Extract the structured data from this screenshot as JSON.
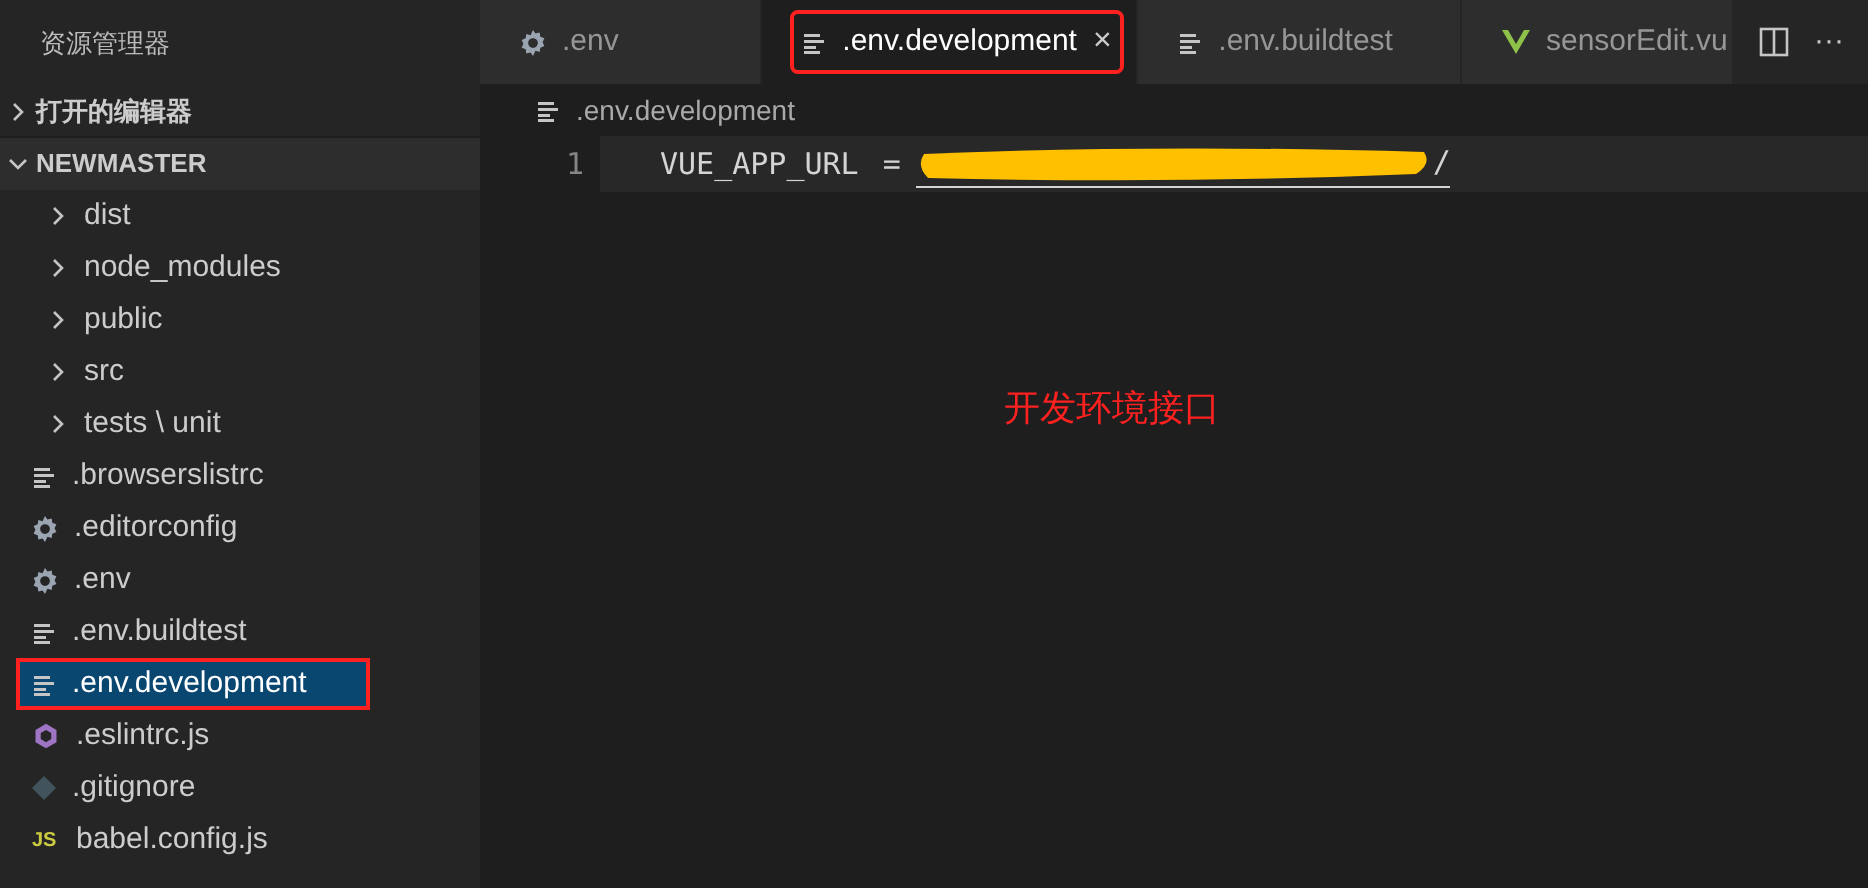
{
  "sidebar": {
    "title": "资源管理器",
    "sections": [
      {
        "label": "打开的编辑器",
        "expanded": false
      },
      {
        "label": "NEWMASTER",
        "expanded": true
      }
    ],
    "items": [
      {
        "kind": "folder",
        "label": "dist",
        "selected": false,
        "annotated": false
      },
      {
        "kind": "folder",
        "label": "node_modules",
        "selected": false,
        "annotated": false
      },
      {
        "kind": "folder",
        "label": "public",
        "selected": false,
        "annotated": false
      },
      {
        "kind": "folder",
        "label": "src",
        "selected": false,
        "annotated": false
      },
      {
        "kind": "folder",
        "label": "tests \\ unit",
        "selected": false,
        "annotated": false
      },
      {
        "kind": "lines",
        "label": ".browserslistrc",
        "selected": false,
        "annotated": false
      },
      {
        "kind": "gear",
        "label": ".editorconfig",
        "selected": false,
        "annotated": false
      },
      {
        "kind": "gear",
        "label": ".env",
        "selected": false,
        "annotated": false
      },
      {
        "kind": "lines",
        "label": ".env.buildtest",
        "selected": false,
        "annotated": false
      },
      {
        "kind": "lines",
        "label": ".env.development",
        "selected": true,
        "annotated": true
      },
      {
        "kind": "eslint",
        "label": ".eslintrc.js",
        "selected": false,
        "annotated": false
      },
      {
        "kind": "git",
        "label": ".gitignore",
        "selected": false,
        "annotated": false
      },
      {
        "kind": "js",
        "label": "babel.config.js",
        "selected": false,
        "annotated": false,
        "badge": "JS"
      }
    ]
  },
  "tabs": [
    {
      "kind": "gear",
      "label": ".env",
      "selected": false,
      "annotated": false
    },
    {
      "kind": "lines",
      "label": ".env.development",
      "selected": true,
      "annotated": true,
      "close": "×"
    },
    {
      "kind": "lines",
      "label": ".env.buildtest",
      "selected": false,
      "annotated": false
    },
    {
      "kind": "vue",
      "label": "sensorEdit.vu",
      "selected": false,
      "annotated": false
    }
  ],
  "tab_actions": {
    "more": "···"
  },
  "breadcrumb": ".env.development",
  "editor": {
    "lines": [
      {
        "number": "1",
        "key": "VUE_APP_URL",
        "operator": "=",
        "value_tail": "/",
        "redacted": true
      }
    ]
  },
  "annotation": "开发环境接口"
}
